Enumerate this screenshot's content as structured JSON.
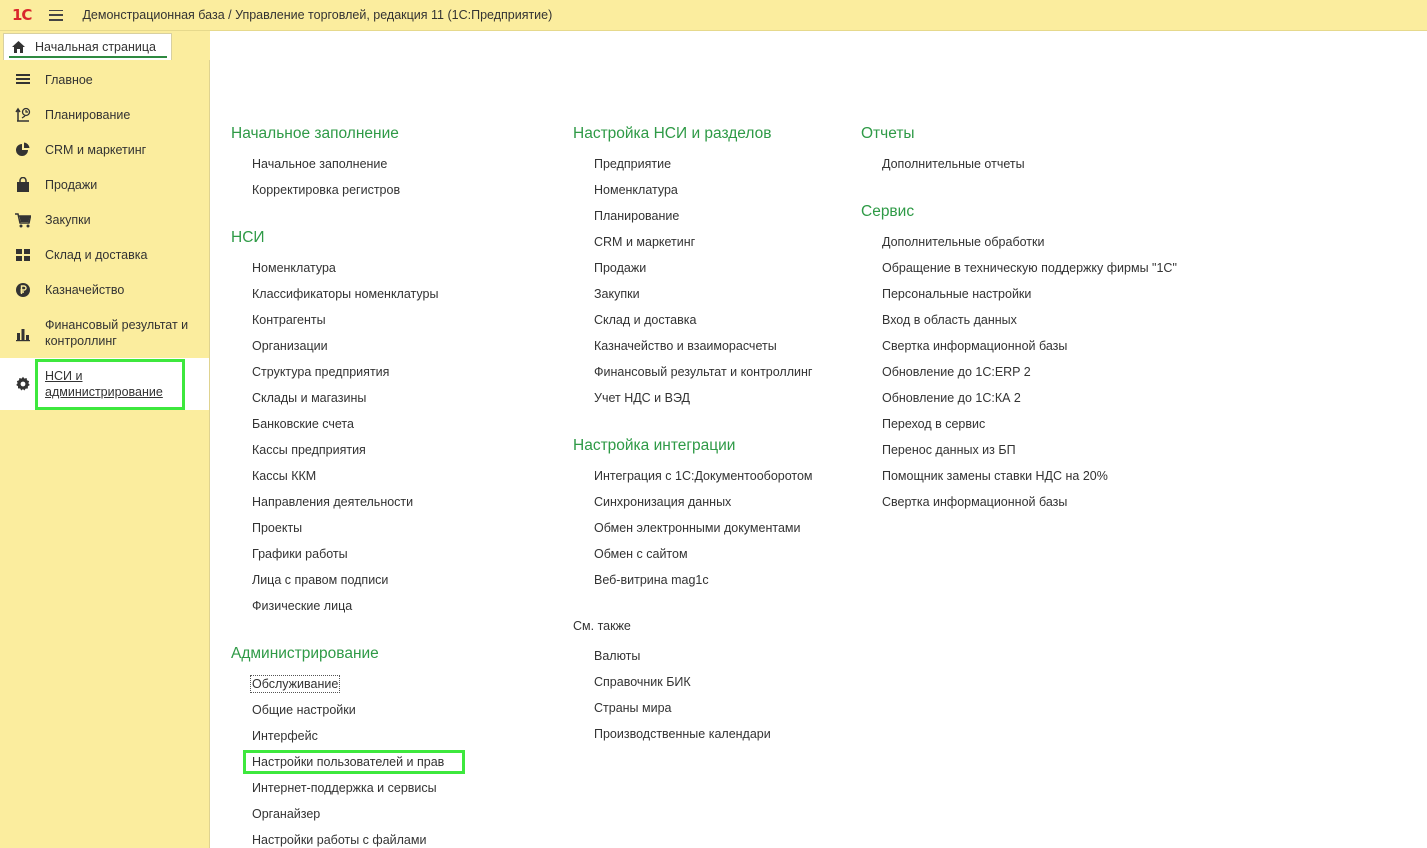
{
  "titlebar": {
    "logo": "1С",
    "title": "Демонстрационная база / Управление торговлей, редакция 11  (1С:Предприятие)"
  },
  "tabs": {
    "home_label": "Начальная страница"
  },
  "sidebar": {
    "items": [
      {
        "label": "Главное",
        "icon": "list-icon"
      },
      {
        "label": "Планирование",
        "icon": "planning-icon"
      },
      {
        "label": "CRM и маркетинг",
        "icon": "pie-chart-icon"
      },
      {
        "label": "Продажи",
        "icon": "shopping-bag-icon"
      },
      {
        "label": "Закупки",
        "icon": "cart-icon"
      },
      {
        "label": "Склад и доставка",
        "icon": "warehouse-grid-icon"
      },
      {
        "label": "Казначейство",
        "icon": "ruble-coin-icon"
      },
      {
        "label": "Финансовый результат и контроллинг",
        "icon": "bar-chart-icon"
      },
      {
        "label": "НСИ и администрирование",
        "icon": "gear-icon",
        "active": true
      }
    ]
  },
  "content": {
    "col1": {
      "sections": [
        {
          "title": "Начальное заполнение",
          "links": [
            "Начальное заполнение",
            "Корректировка регистров"
          ]
        },
        {
          "title": "НСИ",
          "links": [
            "Номенклатура",
            "Классификаторы номенклатуры",
            "Контрагенты",
            "Организации",
            "Структура предприятия",
            "Склады и магазины",
            "Банковские счета",
            "Кассы предприятия",
            "Кассы ККМ",
            "Направления деятельности",
            "Проекты",
            "Графики работы",
            "Лица с правом подписи",
            "Физические лица"
          ]
        },
        {
          "title": "Администрирование",
          "links": [
            "Обслуживание",
            "Общие настройки",
            "Интерфейс",
            "Настройки пользователей и прав",
            "Интернет-поддержка и сервисы",
            "Органайзер",
            "Настройки работы с файлами"
          ]
        }
      ]
    },
    "col2": {
      "sections": [
        {
          "title": "Настройка НСИ и разделов",
          "links": [
            "Предприятие",
            "Номенклатура",
            "Планирование",
            "CRM и маркетинг",
            "Продажи",
            "Закупки",
            "Склад и доставка",
            "Казначейство и взаиморасчеты",
            "Финансовый результат и контроллинг",
            "Учет НДС и ВЭД"
          ]
        },
        {
          "title": "Настройка интеграции",
          "links": [
            "Интеграция с 1С:Документооборотом",
            "Синхронизация данных",
            "Обмен электронными документами",
            "Обмен с сайтом",
            "Веб-витрина mag1c"
          ]
        }
      ],
      "see_also": {
        "title": "См. также",
        "links": [
          "Валюты",
          "Справочник БИК",
          "Страны мира",
          "Производственные календари"
        ]
      }
    },
    "col3": {
      "sections": [
        {
          "title": "Отчеты",
          "links": [
            "Дополнительные отчеты"
          ]
        },
        {
          "title": "Сервис",
          "links": [
            "Дополнительные обработки",
            "Обращение в техническую поддержку фирмы \"1С\"",
            "Персональные настройки",
            "Вход в область данных",
            "Свертка информационной базы",
            "Обновление до 1С:ERP 2",
            "Обновление до 1С:КА 2",
            "Переход в сервис",
            "Перенос данных из БП",
            "Помощник замены ставки НДС на 20%",
            "Свертка информационной базы"
          ]
        }
      ]
    }
  },
  "colors": {
    "sidebar_bg": "#fbed9e",
    "section_heading": "#2e9a46",
    "highlight": "#3de83d",
    "logo_red": "#d9262c"
  }
}
